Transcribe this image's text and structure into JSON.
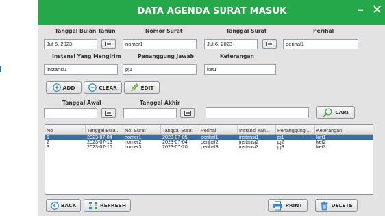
{
  "window": {
    "title": "DATA AGENDA SURAT MASUK",
    "minimize": "–",
    "close": "✕"
  },
  "labels": {
    "tanggal_bulan_tahun": "Tanggal Bulan Tahun",
    "nomor_surat": "Nomor Surat",
    "tanggal_surat": "Tanggal Surat",
    "perihal": "Perihal",
    "instansi": "Instansi Yang Mengirim",
    "penanggung_jawab": "Penanggung Jawab",
    "keterangan": "Keterangan",
    "tanggal_awal": "Tanggal Awal",
    "tanggal_akhir": "Tanggal Akhir"
  },
  "fields": {
    "tanggal_bulan_tahun": "Jul 6, 2023",
    "nomor_surat": "nomer1",
    "tanggal_surat": "Jul 6, 2023",
    "perihal": "perihal1",
    "instansi": "instansi1",
    "penanggung_jawab": "pj1",
    "keterangan": "ket1",
    "tanggal_awal": "",
    "tanggal_akhir": "",
    "search": ""
  },
  "buttons": {
    "add": "ADD",
    "clear": "CLEAR",
    "edit": "EDIT",
    "cari": "CARI",
    "back": "BACK",
    "refresh": "REFRESH",
    "print": "PRINT",
    "delete": "DELETE"
  },
  "table": {
    "headers": [
      "No",
      "Tanggal Bula...",
      "No. Surat",
      "Tanggal Surat",
      "Perihal",
      "Instansi Yan...",
      "Penanggung ...",
      "Keterangan"
    ],
    "rows": [
      {
        "no": "1",
        "tanggal": "2023-07-04",
        "nosurat": "nomer1",
        "tglsurat": "2023-07-05",
        "perihal": "perihal1",
        "instansi": "instansi1",
        "pj": "pj1",
        "ket": "ket1",
        "selected": true
      },
      {
        "no": "2",
        "tanggal": "2023-07-13",
        "nosurat": "nomer2",
        "tglsurat": "2023-07-04",
        "perihal": "perihal2",
        "instansi": "instansi2",
        "pj": "pj2",
        "ket": "ket2",
        "selected": false
      },
      {
        "no": "3",
        "tanggal": "2023-07-16",
        "nosurat": "nomer3",
        "tglsurat": "2023-07-20",
        "perihal": "perihal3",
        "instansi": "instansi3",
        "pj": "pj3",
        "ket": "ket3",
        "selected": false
      }
    ]
  },
  "colors": {
    "titlebar": "#25a84a",
    "selected_row": "#3b6ea5"
  }
}
